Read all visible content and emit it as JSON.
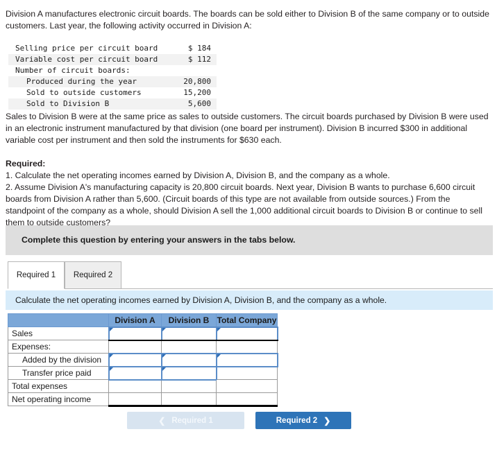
{
  "problem": {
    "intro": "Division A manufactures electronic circuit boards. The boards can be sold either to Division B of the same company or to outside customers. Last year, the following activity occurred in Division A:",
    "exhibit_rows": [
      {
        "label": "Selling price per circuit board",
        "value": "$ 184",
        "indent": false,
        "shaded": false
      },
      {
        "label": "Variable cost per circuit board",
        "value": "$ 112",
        "indent": false,
        "shaded": true
      },
      {
        "label": "Number of circuit boards:",
        "value": "",
        "indent": false,
        "shaded": false
      },
      {
        "label": "Produced during the year",
        "value": "20,800",
        "indent": true,
        "shaded": true
      },
      {
        "label": "Sold to outside customers",
        "value": "15,200",
        "indent": true,
        "shaded": false
      },
      {
        "label": "Sold to Division B",
        "value": "5,600",
        "indent": true,
        "shaded": true
      }
    ],
    "paragraph2": "Sales to Division B were at the same price as sales to outside customers. The circuit boards purchased by Division B were used in an electronic instrument manufactured by that division (one board per instrument). Division B incurred $300 in additional variable cost per instrument and then sold the instruments for $630 each.",
    "required_heading": "Required:",
    "required_items": [
      "1. Calculate the net operating incomes earned by Division A, Division B, and the company as a whole.",
      "2. Assume Division A's manufacturing capacity is 20,800 circuit boards. Next year, Division B wants to purchase 6,600 circuit boards from Division A rather than 5,600. (Circuit boards of this type are not available from outside sources.) From the standpoint of the company as a whole, should Division A sell the 1,000 additional circuit boards to Division B or continue to sell them to outside customers?"
    ]
  },
  "gray_banner": {
    "text": "Complete this question by entering your answers in the tabs below."
  },
  "tabs": [
    {
      "label": "Required 1",
      "active": true
    },
    {
      "label": "Required 2",
      "active": false
    }
  ],
  "blue_banner": {
    "text": "Calculate the net operating incomes earned by Division A, Division B, and the company as a whole."
  },
  "answer_table": {
    "columns": [
      "Division A",
      "Division B",
      "Total Company"
    ],
    "rows": [
      {
        "label": "Sales",
        "indent": false,
        "cells": [
          "",
          "",
          ""
        ],
        "input": [
          true,
          true,
          true
        ],
        "rule_under": true
      },
      {
        "label": "Expenses:",
        "indent": false,
        "cells": [
          "",
          "",
          ""
        ],
        "input": [
          false,
          false,
          false
        ],
        "rule_under": false
      },
      {
        "label": "Added by the division",
        "indent": true,
        "cells": [
          "",
          "",
          ""
        ],
        "input": [
          true,
          true,
          true
        ],
        "rule_under": false
      },
      {
        "label": "Transfer price paid",
        "indent": true,
        "cells": [
          "",
          "",
          ""
        ],
        "input": [
          true,
          true,
          false
        ],
        "rule_under": false
      },
      {
        "label": "Total expenses",
        "indent": false,
        "cells": [
          "",
          "",
          ""
        ],
        "input": [
          false,
          false,
          false
        ],
        "rule_under": false
      },
      {
        "label": "Net operating income",
        "indent": false,
        "cells": [
          "",
          "",
          ""
        ],
        "input": [
          false,
          false,
          false
        ],
        "rule_under": false
      }
    ]
  },
  "nav": {
    "prev_label": "Required 1",
    "prev_icon": "chevron-left-icon",
    "next_label": "Required 2",
    "next_icon": "chevron-right-icon"
  },
  "colors": {
    "header_blue": "#7ba7d8",
    "banner_blue": "#d8ecfa",
    "banner_gray": "#dedede",
    "button_blue": "#2e74b8",
    "button_disabled": "#d8e4f0",
    "input_border": "#5b8dc8"
  }
}
